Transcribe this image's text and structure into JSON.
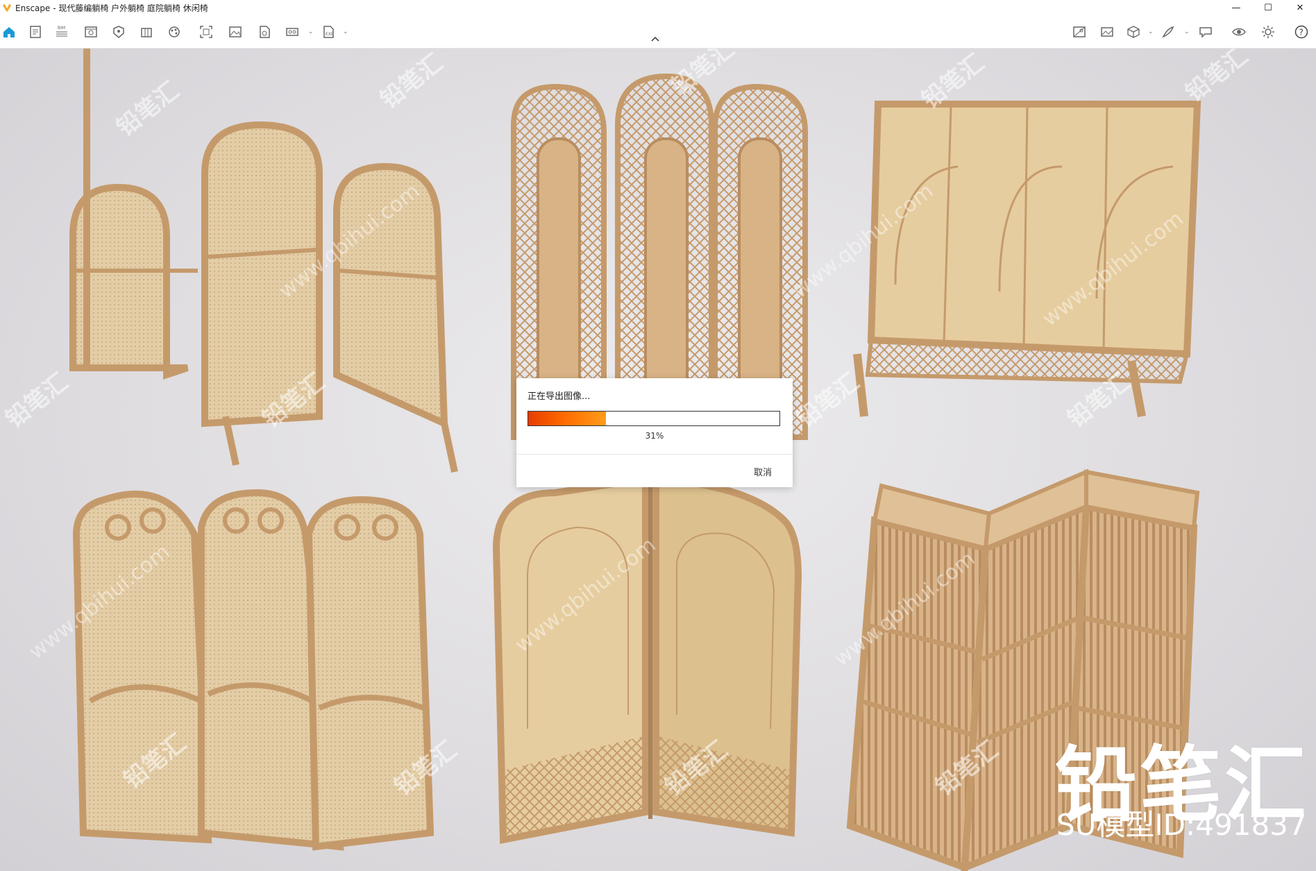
{
  "window": {
    "app_name": "Enscape",
    "title": "Enscape - 现代藤编躺椅 户外躺椅 庭院躺椅 休闲椅",
    "minimize": "—",
    "maximize": "☐",
    "close": "✕"
  },
  "toolbar": {
    "left_icons": [
      "home-icon",
      "document-icon",
      "bim-icon",
      "view-icon",
      "asset-icon",
      "library-icon",
      "materials-icon",
      "screenshot-icon",
      "image-icon",
      "render-icon",
      "batch-icon",
      "export-icon"
    ],
    "right_icons": [
      "map-icon",
      "panorama-icon",
      "box-icon",
      "feather-icon",
      "chat-icon",
      "eye-icon",
      "settings-icon",
      "help-icon"
    ]
  },
  "export_dialog": {
    "title": "正在导出图像...",
    "progress_value": 31,
    "progress_label": "31%",
    "cancel_label": "取消"
  },
  "watermark": {
    "brand": "铅笔汇",
    "model_id": "SU模型ID:491837",
    "tile_text": "铅笔汇",
    "tile_url": "www.qbihui.com"
  },
  "colors": {
    "accent": "#1a9ad6",
    "progress_start": "#e63d00",
    "progress_end": "#ff9d1a",
    "wood": "#c9a27a",
    "rattan": "#e2c99d"
  }
}
